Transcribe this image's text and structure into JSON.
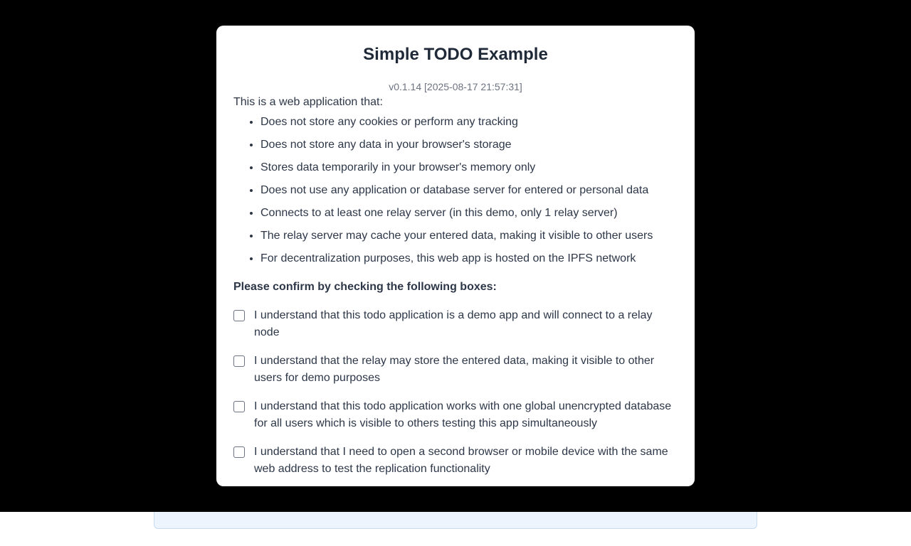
{
  "modal": {
    "title": "Simple TODO Example",
    "version": "v0.1.14 [2025-08-17 21:57:31]",
    "intro": "This is a web application that:",
    "features": [
      "Does not store any cookies or perform any tracking",
      "Does not store any data in your browser's storage",
      "Stores data temporarily in your browser's memory only",
      "Does not use any application or database server for entered or personal data",
      "Connects to at least one relay server (in this demo, only 1 relay server)",
      "The relay server may cache your entered data, making it visible to other users",
      "For decentralization purposes, this web app is hosted on the IPFS network"
    ],
    "confirm_heading": "Please confirm by checking the following boxes:",
    "checkboxes": [
      "I understand that this todo application is a demo app and will connect to a relay node",
      "I understand that the relay may store the entered data, making it visible to other users for demo purposes",
      "I understand that this todo application works with one global unencrypted database for all users which is visible to others testing this app simultaneously",
      "I understand that I need to open a second browser or mobile device with the same web address to test the replication functionality"
    ]
  }
}
